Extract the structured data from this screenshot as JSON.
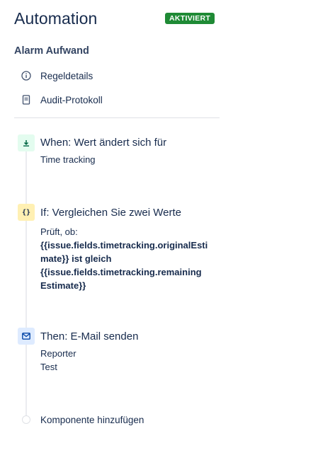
{
  "header": {
    "title": "Automation",
    "status_badge": "AKTIVIERT"
  },
  "rule": {
    "name": "Alarm Aufwand",
    "nav": [
      {
        "icon": "info-icon",
        "label": "Regeldetails"
      },
      {
        "icon": "document-icon",
        "label": "Audit-Protokoll"
      }
    ]
  },
  "steps": {
    "trigger": {
      "icon": "download-arrow-icon",
      "title": "When: Wert ändert sich für",
      "detail": "Time tracking"
    },
    "condition": {
      "icon": "braces-icon",
      "icon_glyph": "{}",
      "title": "If: Vergleichen Sie zwei Werte",
      "intro": "Prüft, ob:",
      "expr_line1": "{{issue.fields.timetracking.originalEsti",
      "expr_line2": "mate}} ist gleich",
      "expr_line3": "{{issue.fields.timetracking.remaining",
      "expr_line4": "Estimate}}"
    },
    "action": {
      "icon": "mail-icon",
      "title": "Then: E-Mail senden",
      "detail_1": "Reporter",
      "detail_2": "Test"
    }
  },
  "add_component": {
    "label": "Komponente hinzufügen"
  },
  "colors": {
    "badge_bg": "#1f8a35",
    "trigger_bg": "#e3fcef",
    "condition_bg": "#fff0b3",
    "action_bg": "#deebff"
  }
}
